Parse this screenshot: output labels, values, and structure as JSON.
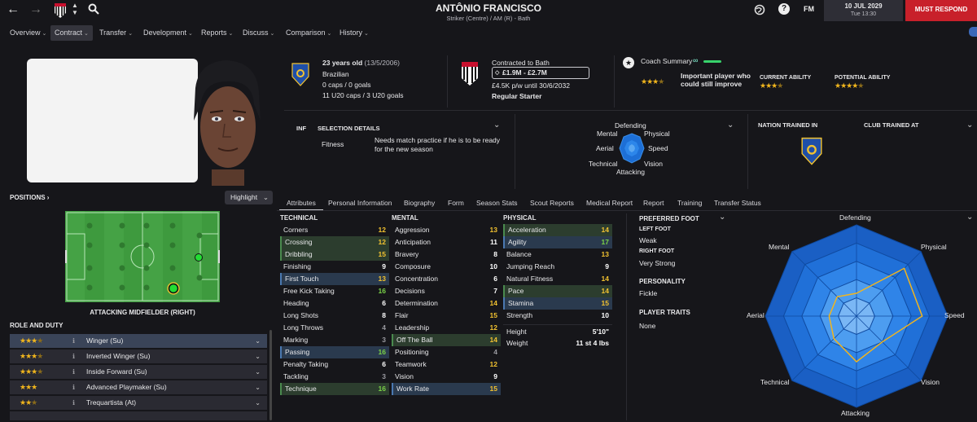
{
  "header": {
    "player_name": "ANTÔNIO FRANCISCO",
    "player_sub": "Striker (Centre) / AM (R) - Bath",
    "date": "10 JUL 2029",
    "time": "Tue 13:30",
    "must_respond": "MUST RESPOND",
    "fm_label": "FM",
    "help_label": "?"
  },
  "nav": {
    "items": [
      "Overview",
      "Contract",
      "Transfer",
      "Development",
      "Reports",
      "Discuss",
      "Comparison",
      "History"
    ]
  },
  "profile": {
    "age": "23 years old",
    "dob": "(13/5/2006)",
    "nationality": "Brazilian",
    "caps": "0 caps / 0 goals",
    "u20_caps": "11 U20 caps / 3 U20 goals",
    "contract_to": "Contracted to Bath",
    "value": "£1.9M - £2.7M",
    "wage": "£4.5K p/w until 30/6/2032",
    "squad_status": "Regular Starter",
    "coach_summary_label": "Coach Summary",
    "coach_summary_text": "Important player who could still improve",
    "current_ability_label": "CURRENT ABILITY",
    "potential_ability_label": "POTENTIAL ABILITY"
  },
  "selection": {
    "inf": "INF",
    "title": "SELECTION DETAILS",
    "fitness_label": "Fitness",
    "fitness_text": "Needs match practice if he is to be ready for the new season"
  },
  "mini_polar": {
    "labels": [
      "Defending",
      "Physical",
      "Speed",
      "Vision",
      "Attacking",
      "Technical",
      "Aerial",
      "Mental"
    ]
  },
  "trained": {
    "nation_label": "NATION TRAINED IN",
    "club_label": "CLUB TRAINED AT"
  },
  "positions": {
    "label": "POSITIONS",
    "highlight": "Highlight",
    "role_label": "ATTACKING MIDFIELDER (RIGHT)"
  },
  "role_duty": {
    "label": "ROLE AND DUTY",
    "roles": [
      {
        "name": "Winger (Su)",
        "stars": 3.5
      },
      {
        "name": "Inverted Winger (Su)",
        "stars": 3.5
      },
      {
        "name": "Inside Forward (Su)",
        "stars": 3.5
      },
      {
        "name": "Advanced Playmaker (Su)",
        "stars": 3
      },
      {
        "name": "Trequartista (At)",
        "stars": 2.5
      }
    ]
  },
  "tabs": [
    "Attributes",
    "Personal Information",
    "Biography",
    "Form",
    "Season Stats",
    "Scout Reports",
    "Medical Report",
    "Report",
    "Training",
    "Transfer Status"
  ],
  "technical": {
    "title": "TECHNICAL",
    "rows": [
      {
        "n": "Corners",
        "v": "12"
      },
      {
        "n": "Crossing",
        "v": "12"
      },
      {
        "n": "Dribbling",
        "v": "15"
      },
      {
        "n": "Finishing",
        "v": "9"
      },
      {
        "n": "First Touch",
        "v": "13"
      },
      {
        "n": "Free Kick Taking",
        "v": "16"
      },
      {
        "n": "Heading",
        "v": "6"
      },
      {
        "n": "Long Shots",
        "v": "8"
      },
      {
        "n": "Long Throws",
        "v": "4"
      },
      {
        "n": "Marking",
        "v": "3"
      },
      {
        "n": "Passing",
        "v": "16"
      },
      {
        "n": "Penalty Taking",
        "v": "6"
      },
      {
        "n": "Tackling",
        "v": "3"
      },
      {
        "n": "Technique",
        "v": "16"
      }
    ]
  },
  "mental": {
    "title": "MENTAL",
    "rows": [
      {
        "n": "Aggression",
        "v": "13"
      },
      {
        "n": "Anticipation",
        "v": "11"
      },
      {
        "n": "Bravery",
        "v": "8"
      },
      {
        "n": "Composure",
        "v": "10"
      },
      {
        "n": "Concentration",
        "v": "6"
      },
      {
        "n": "Decisions",
        "v": "7"
      },
      {
        "n": "Determination",
        "v": "14"
      },
      {
        "n": "Flair",
        "v": "15"
      },
      {
        "n": "Leadership",
        "v": "12"
      },
      {
        "n": "Off The Ball",
        "v": "14"
      },
      {
        "n": "Positioning",
        "v": "4"
      },
      {
        "n": "Teamwork",
        "v": "12"
      },
      {
        "n": "Vision",
        "v": "9"
      },
      {
        "n": "Work Rate",
        "v": "15"
      }
    ]
  },
  "physical": {
    "title": "PHYSICAL",
    "rows": [
      {
        "n": "Acceleration",
        "v": "14"
      },
      {
        "n": "Agility",
        "v": "17"
      },
      {
        "n": "Balance",
        "v": "13"
      },
      {
        "n": "Jumping Reach",
        "v": "9"
      },
      {
        "n": "Natural Fitness",
        "v": "14"
      },
      {
        "n": "Pace",
        "v": "14"
      },
      {
        "n": "Stamina",
        "v": "15"
      },
      {
        "n": "Strength",
        "v": "10"
      }
    ],
    "height_label": "Height",
    "height": "5'10\"",
    "weight_label": "Weight",
    "weight": "11 st 4 lbs"
  },
  "side_info": {
    "preferred_foot": "PREFERRED FOOT",
    "left_foot_label": "LEFT FOOT",
    "left_foot": "Weak",
    "right_foot_label": "RIGHT FOOT",
    "right_foot": "Very Strong",
    "personality_label": "PERSONALITY",
    "personality": "Fickle",
    "traits_label": "PLAYER TRAITS",
    "traits": "None"
  },
  "big_polar": {
    "labels": [
      "Defending",
      "Physical",
      "Speed",
      "Vision",
      "Attacking",
      "Technical",
      "Aerial",
      "Mental"
    ],
    "values": [
      0.25,
      0.74,
      0.72,
      0.4,
      0.5,
      0.35,
      0.3,
      0.3
    ]
  }
}
